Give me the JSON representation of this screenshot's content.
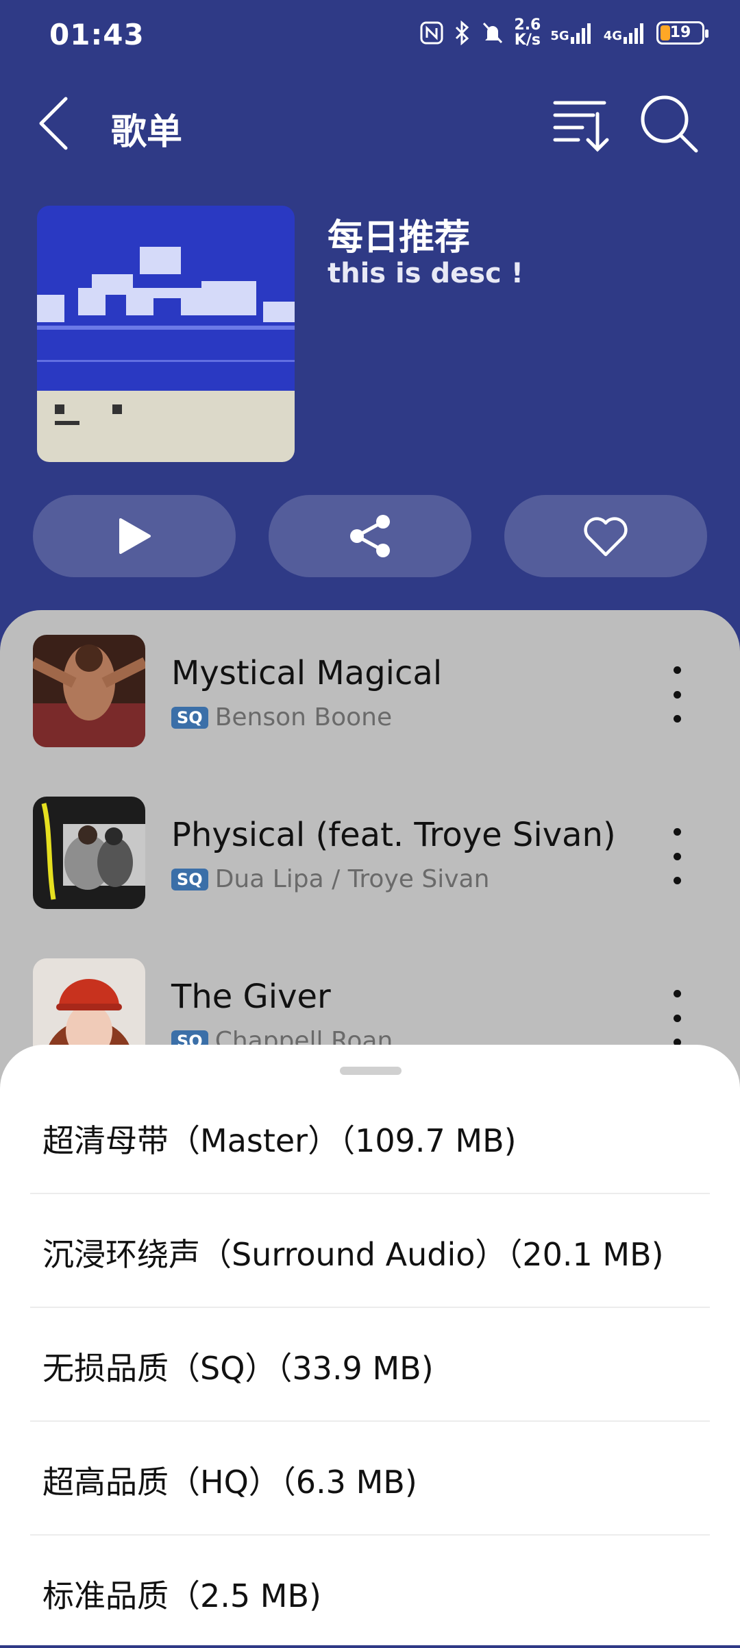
{
  "status_bar": {
    "time": "01:43",
    "net_speed_top": "2.6",
    "net_speed_bottom": "K/s",
    "net1": "5G",
    "net2": "4G",
    "battery": "19"
  },
  "header": {
    "title": "歌单",
    "back_icon": "chevron-left-icon",
    "sort_icon": "sort-icon",
    "search_icon": "search-icon"
  },
  "playlist": {
    "title": "每日推荐",
    "description": "this is desc !"
  },
  "actions": [
    {
      "name": "play",
      "icon": "play-icon"
    },
    {
      "name": "share",
      "icon": "share-icon"
    },
    {
      "name": "favorite",
      "icon": "heart-icon"
    }
  ],
  "songs": [
    {
      "title": "Mystical Magical",
      "artist": "Benson Boone",
      "badge": "SQ"
    },
    {
      "title": "Physical (feat. Troye Sivan)",
      "artist": "Dua Lipa / Troye Sivan",
      "badge": "SQ"
    },
    {
      "title": "The Giver",
      "artist": "Chappell Roan",
      "badge": "SQ"
    }
  ],
  "quality_sheet": {
    "options": [
      "超清母带（Master）（109.7 MB)",
      "沉浸环绕声（Surround Audio）（20.1 MB)",
      "无损品质（SQ）（33.9 MB)",
      "超高品质（HQ）（6.3 MB)",
      "标准品质（2.5 MB)"
    ]
  },
  "colors": {
    "header_bg": "#2f3a86",
    "list_bg": "#bdbdbd",
    "sheet_bg": "#ffffff",
    "sq_badge": "#3b6fa8"
  }
}
